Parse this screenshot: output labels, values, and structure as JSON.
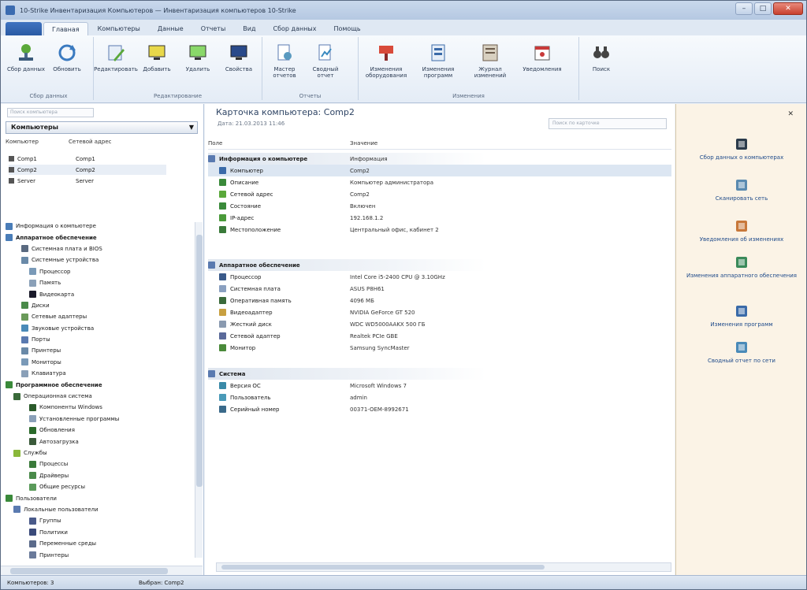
{
  "window": {
    "title": "10-Strike Инвентаризация Компьютеров — Инвентаризация компьютеров 10-Strike",
    "buttons": {
      "minimize": "–",
      "maximize": "□",
      "close": "✕"
    }
  },
  "ribbon_tabs": {
    "file": "",
    "items": [
      "Главная",
      "Компьютеры",
      "Данные",
      "Отчеты",
      "Вид",
      "Сбор данных",
      "Помощь"
    ]
  },
  "ribbon_groups": [
    {
      "label": "Сбор данных",
      "buttons": [
        "Сбор данных",
        "Обновить"
      ]
    },
    {
      "label": "Редактирование",
      "buttons": [
        "Редактировать",
        "Добавить",
        "Удалить",
        "Свойства"
      ]
    },
    {
      "label": "Отчеты",
      "buttons": [
        "Мастер отчетов",
        "Сводный отчет"
      ]
    },
    {
      "label": "Изменения",
      "buttons": [
        "Изменения оборудования",
        "Изменения программ",
        "Журнал изменений",
        "Уведомления"
      ]
    },
    {
      "label": "",
      "buttons": [
        "Поиск"
      ]
    }
  ],
  "left": {
    "search_placeholder": "Поиск компьютера",
    "group_combo": "Компьютеры",
    "headers": [
      "Компьютер",
      "Сетевой адрес"
    ],
    "rows": [
      [
        "Comp1",
        "Comp1"
      ],
      [
        "Comp2",
        "Comp2"
      ],
      [
        "Server",
        "Server"
      ]
    ],
    "tree": [
      {
        "label": "Информация о компьютере",
        "level": 0,
        "bold": false,
        "color": "#4a7db8"
      },
      {
        "label": "Аппаратное обеспечение",
        "level": 0,
        "bold": true,
        "color": "#4a7db8"
      },
      {
        "label": "Системная плата и BIOS",
        "level": 2,
        "bold": false,
        "color": "#5a6a80"
      },
      {
        "label": "Системные устройства",
        "level": 2,
        "bold": false,
        "color": "#6a8aa8"
      },
      {
        "label": "Процессор",
        "level": 3,
        "bold": false,
        "color": "#7a9ab8"
      },
      {
        "label": "Память",
        "level": 3,
        "bold": false,
        "color": "#8aa0b8"
      },
      {
        "label": "Видеокарта",
        "level": 3,
        "bold": false,
        "color": "#1a1a2a"
      },
      {
        "label": "Диски",
        "level": 2,
        "bold": false,
        "color": "#4a8a4a"
      },
      {
        "label": "Сетевые адаптеры",
        "level": 2,
        "bold": false,
        "color": "#6a9a5a"
      },
      {
        "label": "Звуковые устройства",
        "level": 2,
        "bold": false,
        "color": "#4a8ab8"
      },
      {
        "label": "Порты",
        "level": 2,
        "bold": false,
        "color": "#5a7ab0"
      },
      {
        "label": "Принтеры",
        "level": 2,
        "bold": false,
        "color": "#6a8aa8"
      },
      {
        "label": "Мониторы",
        "level": 2,
        "bold": false,
        "color": "#7a9ab8"
      },
      {
        "label": "Клавиатура",
        "level": 2,
        "bold": false,
        "color": "#8aa0b8"
      },
      {
        "label": "Программное обеспечение",
        "level": 0,
        "bold": true,
        "color": "#3a8a3a"
      },
      {
        "label": "Операционная система",
        "level": 1,
        "bold": false,
        "color": "#3a6a3a"
      },
      {
        "label": "Компоненты Windows",
        "level": 3,
        "bold": false,
        "color": "#2a5a2a"
      },
      {
        "label": "Установленные программы",
        "level": 3,
        "bold": false,
        "color": "#8aa0b8"
      },
      {
        "label": "Обновления",
        "level": 3,
        "bold": false,
        "color": "#2a6a2a"
      },
      {
        "label": "Автозагрузка",
        "level": 3,
        "bold": false,
        "color": "#3a5a3a"
      },
      {
        "label": "Службы",
        "level": 1,
        "bold": false,
        "color": "#8ab83a"
      },
      {
        "label": "Процессы",
        "level": 3,
        "bold": false,
        "color": "#3a7a3a"
      },
      {
        "label": "Драйверы",
        "level": 3,
        "bold": false,
        "color": "#4a8a4a"
      },
      {
        "label": "Общие ресурсы",
        "level": 3,
        "bold": false,
        "color": "#5a9a5a"
      },
      {
        "label": "Пользователи",
        "level": 0,
        "bold": false,
        "color": "#3a8a3a"
      },
      {
        "label": "Локальные пользователи",
        "level": 1,
        "bold": false,
        "color": "#5a7ab0"
      },
      {
        "label": "Группы",
        "level": 3,
        "bold": false,
        "color": "#4a5a8a"
      },
      {
        "label": "Политики",
        "level": 3,
        "bold": false,
        "color": "#3a4a7a"
      },
      {
        "label": "Переменные среды",
        "level": 3,
        "bold": false,
        "color": "#5a6a8a"
      },
      {
        "label": "Принтеры",
        "level": 3,
        "bold": false,
        "color": "#6a7a9a"
      }
    ]
  },
  "main": {
    "title": "Карточка компьютера: Comp2",
    "date": "Дата: 21.03.2013 11:46",
    "search_placeholder": "Поиск по карточке",
    "headers": [
      "Поле",
      "Значение"
    ],
    "sections": [
      {
        "title": "Информация о компьютере",
        "value": "Информация",
        "items": [
          {
            "label": "Компьютер",
            "value": "Comp2",
            "color": "#3a6aa8",
            "highlight": true
          },
          {
            "label": "Описание",
            "value": "Компьютер администратора",
            "color": "#3a8a3a",
            "highlight": false
          },
          {
            "label": "Сетевой адрес",
            "value": "Comp2",
            "color": "#5aa83a",
            "highlight": false
          },
          {
            "label": "Состояние",
            "value": "Включен",
            "color": "#3a8a3a",
            "highlight": false
          },
          {
            "label": "IP-адрес",
            "value": "192.168.1.2",
            "color": "#4a9a3a",
            "highlight": false
          },
          {
            "label": "Местоположение",
            "value": "Центральный офис, кабинет 2",
            "color": "#3a7a3a",
            "highlight": false
          }
        ]
      },
      {
        "title": "Аппаратное обеспечение",
        "value": "",
        "items": [
          {
            "label": "Процессор",
            "value": "Intel Core i5-2400 CPU @ 3.10GHz",
            "color": "#3a5a8a",
            "highlight": false
          },
          {
            "label": "Системная плата",
            "value": "ASUS P8H61",
            "color": "#8aa0c0",
            "highlight": false
          },
          {
            "label": "Оперативная память",
            "value": "4096 МБ",
            "color": "#3a6a3a",
            "highlight": false
          },
          {
            "label": "Видеоадаптер",
            "value": "NVIDIA GeForce GT 520",
            "color": "#c8a040",
            "highlight": false
          },
          {
            "label": "Жесткий диск",
            "value": "WDC WD5000AAKX 500 ГБ",
            "color": "#8a9ab0",
            "highlight": false
          },
          {
            "label": "Сетевой адаптер",
            "value": "Realtek PCIe GBE",
            "color": "#5a6a9a",
            "highlight": false
          },
          {
            "label": "Монитор",
            "value": "Samsung SyncMaster",
            "color": "#4a8a3a",
            "highlight": false
          }
        ]
      },
      {
        "title": "Система",
        "value": "",
        "items": [
          {
            "label": "Версия ОС",
            "value": "Microsoft Windows 7",
            "color": "#3a8aa8",
            "highlight": false
          },
          {
            "label": "Пользователь",
            "value": "admin",
            "color": "#4a9ab8",
            "highlight": false
          },
          {
            "label": "Серийный номер",
            "value": "00371-OEM-8992671",
            "color": "#3a6a8a",
            "highlight": false
          }
        ]
      }
    ]
  },
  "tasks": {
    "pin": "✕",
    "items": [
      {
        "label": "Сбор данных о компьютерах",
        "icon": "network-icon",
        "color": "#2a3a4a"
      },
      {
        "label": "Сканировать сеть",
        "icon": "scan-icon",
        "color": "#5a8ab0"
      },
      {
        "label": "Уведомления об изменениях",
        "icon": "alert-icon",
        "color": "#c8783a"
      },
      {
        "label": "Изменения аппаратного обеспечения",
        "icon": "hardware-icon",
        "color": "#3a8a5a"
      },
      {
        "label": "Изменения программ",
        "icon": "software-icon",
        "color": "#3a6aa8"
      },
      {
        "label": "Сводный отчет по сети",
        "icon": "report-icon",
        "color": "#4a8ab8"
      }
    ]
  },
  "status": {
    "left": "Компьютеров: 3",
    "middle": "Выбран: Comp2"
  }
}
